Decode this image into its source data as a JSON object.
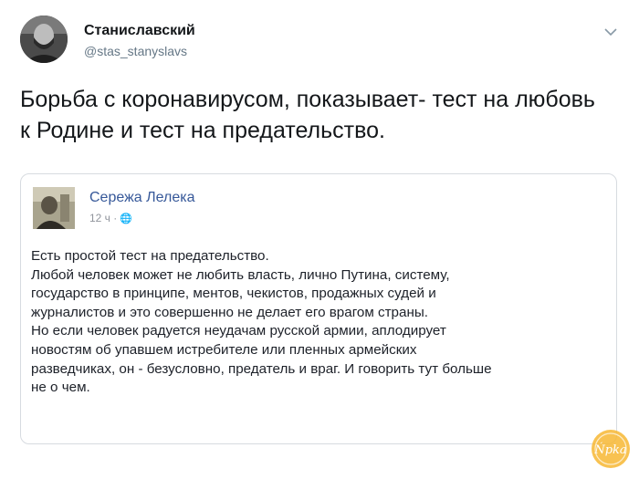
{
  "tweet": {
    "author_name": "Станиславский",
    "author_handle": "@stas_stanyslavs",
    "text": "Борьба с коронавирусом, показывает- тест на любовь к Родине и тест на предательство."
  },
  "embedded_post": {
    "author_name": "Сережа Лелека",
    "time": "12 ч ·",
    "lines": [
      "Есть простой тест на предательство.",
      "Любой человек может не любить власть, лично Путина, систему,",
      "государство в принципе, ментов, чекистов, продажных судей и",
      "журналистов и это совершенно не делает его врагом страны.",
      "Но если человек радуется неудачам русской армии, аплодирует",
      "новостям об упавшем истребителе или пленных армейских",
      "разведчиках, он - безусловно, предатель и враг. И говорить тут больше",
      "не о чем."
    ]
  },
  "watermark": {
    "text": "Ńpka"
  },
  "icons": {
    "menu": "chevron-down-icon",
    "privacy": "globe-icon"
  },
  "colors": {
    "fb_link": "#365899",
    "muted": "#657786",
    "watermark": "#f5a623"
  }
}
